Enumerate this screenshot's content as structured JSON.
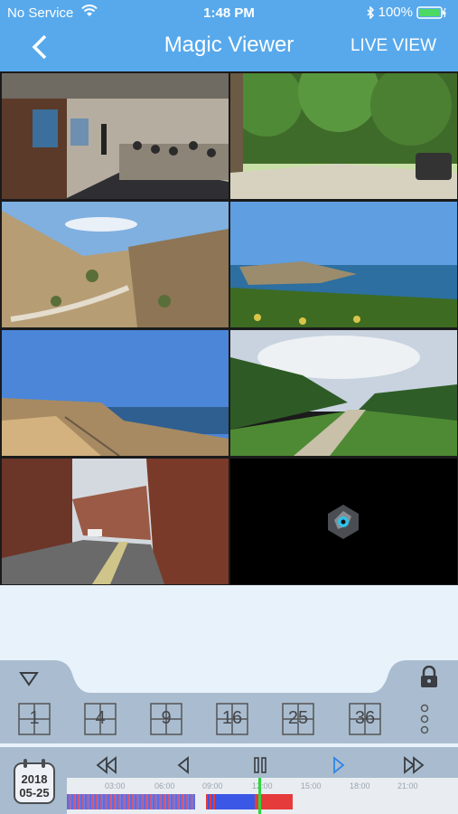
{
  "status": {
    "carrier": "No Service",
    "time": "1:48 PM",
    "battery": "100%"
  },
  "header": {
    "title": "Magic Viewer",
    "live_view": "LIVE VIEW"
  },
  "grid": {
    "cells": [
      "meeting-room",
      "park-trees",
      "desert-valley",
      "coast-cliff",
      "seaside-path",
      "tree-avenue",
      "brick-street",
      "empty"
    ]
  },
  "layouts": [
    "1",
    "4",
    "9",
    "16",
    "25",
    "36"
  ],
  "timeline": {
    "date_year": "2018",
    "date_md": "05-25",
    "ticks": [
      "03:00",
      "06:00",
      "09:00",
      "12:00",
      "15:00",
      "18:00",
      "21:00"
    ]
  },
  "colors": {
    "header": "#57a9ec",
    "record_continuous": "#3b57e6",
    "record_alarm": "#e63b3b",
    "cursor": "#2bd63b"
  }
}
